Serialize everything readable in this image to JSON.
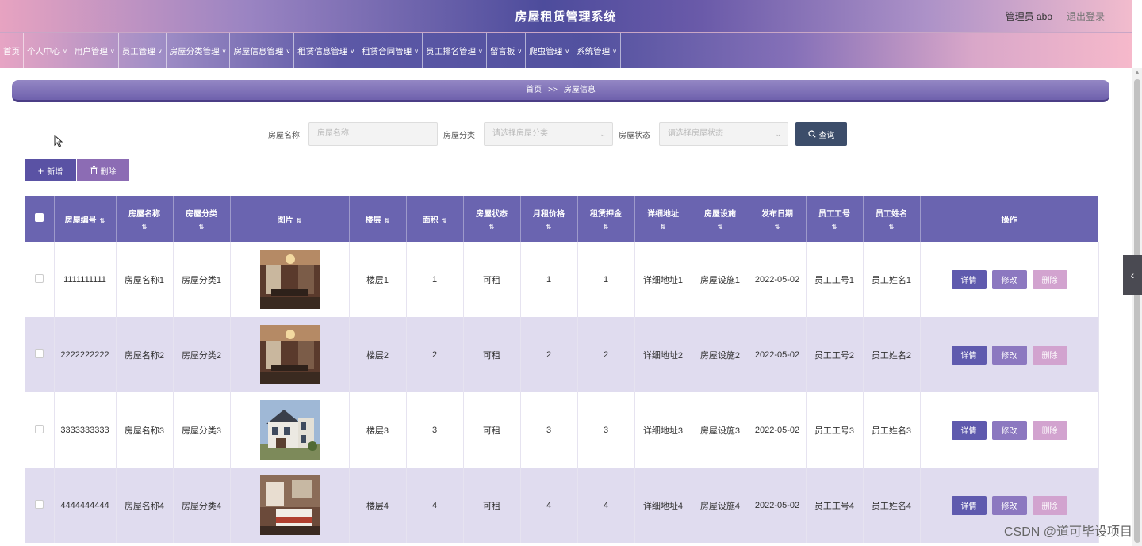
{
  "header": {
    "title": "房屋租赁管理系统",
    "admin_label": "管理员 abo",
    "logout": "退出登录"
  },
  "nav": [
    {
      "label": "首页",
      "dropdown": false
    },
    {
      "label": "个人中心",
      "dropdown": true
    },
    {
      "label": "用户管理",
      "dropdown": true
    },
    {
      "label": "员工管理",
      "dropdown": true
    },
    {
      "label": "房屋分类管理",
      "dropdown": true
    },
    {
      "label": "房屋信息管理",
      "dropdown": true
    },
    {
      "label": "租赁信息管理",
      "dropdown": true
    },
    {
      "label": "租赁合同管理",
      "dropdown": true
    },
    {
      "label": "员工排名管理",
      "dropdown": true
    },
    {
      "label": "留言板",
      "dropdown": true
    },
    {
      "label": "爬虫管理",
      "dropdown": true
    },
    {
      "label": "系统管理",
      "dropdown": true
    }
  ],
  "breadcrumb": {
    "home": "首页",
    "sep": ">>",
    "current": "房屋信息"
  },
  "search": {
    "name_label": "房屋名称",
    "name_placeholder": "房屋名称",
    "category_label": "房屋分类",
    "category_placeholder": "请选择房屋分类",
    "status_label": "房屋状态",
    "status_placeholder": "请选择房屋状态",
    "query_button": "查询"
  },
  "actions": {
    "add": "新增",
    "delete": "删除"
  },
  "table": {
    "columns": [
      "房屋编号",
      "房屋名称",
      "房屋分类",
      "图片",
      "楼层",
      "面积",
      "房屋状态",
      "月租价格",
      "租赁押金",
      "详细地址",
      "房屋设施",
      "发布日期",
      "员工工号",
      "员工姓名",
      "操作"
    ],
    "rows": [
      {
        "id": "1111111111",
        "name": "房屋名称1",
        "category": "房屋分类1",
        "image": "room-interior-photo",
        "floor": "楼层1",
        "area": "1",
        "status": "可租",
        "rent": "1",
        "deposit": "1",
        "address": "详细地址1",
        "facilities": "房屋设施1",
        "date": "2022-05-02",
        "emp_no": "员工工号1",
        "emp_name": "员工姓名1"
      },
      {
        "id": "2222222222",
        "name": "房屋名称2",
        "category": "房屋分类2",
        "image": "room-interior-photo",
        "floor": "楼层2",
        "area": "2",
        "status": "可租",
        "rent": "2",
        "deposit": "2",
        "address": "详细地址2",
        "facilities": "房屋设施2",
        "date": "2022-05-02",
        "emp_no": "员工工号2",
        "emp_name": "员工姓名2"
      },
      {
        "id": "3333333333",
        "name": "房屋名称3",
        "category": "房屋分类3",
        "image": "house-exterior-photo",
        "floor": "楼层3",
        "area": "3",
        "status": "可租",
        "rent": "3",
        "deposit": "3",
        "address": "详细地址3",
        "facilities": "房屋设施3",
        "date": "2022-05-02",
        "emp_no": "员工工号3",
        "emp_name": "员工姓名3"
      },
      {
        "id": "4444444444",
        "name": "房屋名称4",
        "category": "房屋分类4",
        "image": "bedroom-photo",
        "floor": "楼层4",
        "area": "4",
        "status": "可租",
        "rent": "4",
        "deposit": "4",
        "address": "详细地址4",
        "facilities": "房屋设施4",
        "date": "2022-05-02",
        "emp_no": "员工工号4",
        "emp_name": "员工姓名4"
      }
    ],
    "row_actions": {
      "detail": "详情",
      "edit": "修改",
      "delete": "删除"
    }
  },
  "watermark": "CSDN @道可毕设项目",
  "colors": {
    "primary": "#6a64b0",
    "query_button": "#3c4d6a",
    "add_button": "#5a52a4",
    "delete_button": "#8c6cb4",
    "row_delete": "#d2a3cf"
  }
}
